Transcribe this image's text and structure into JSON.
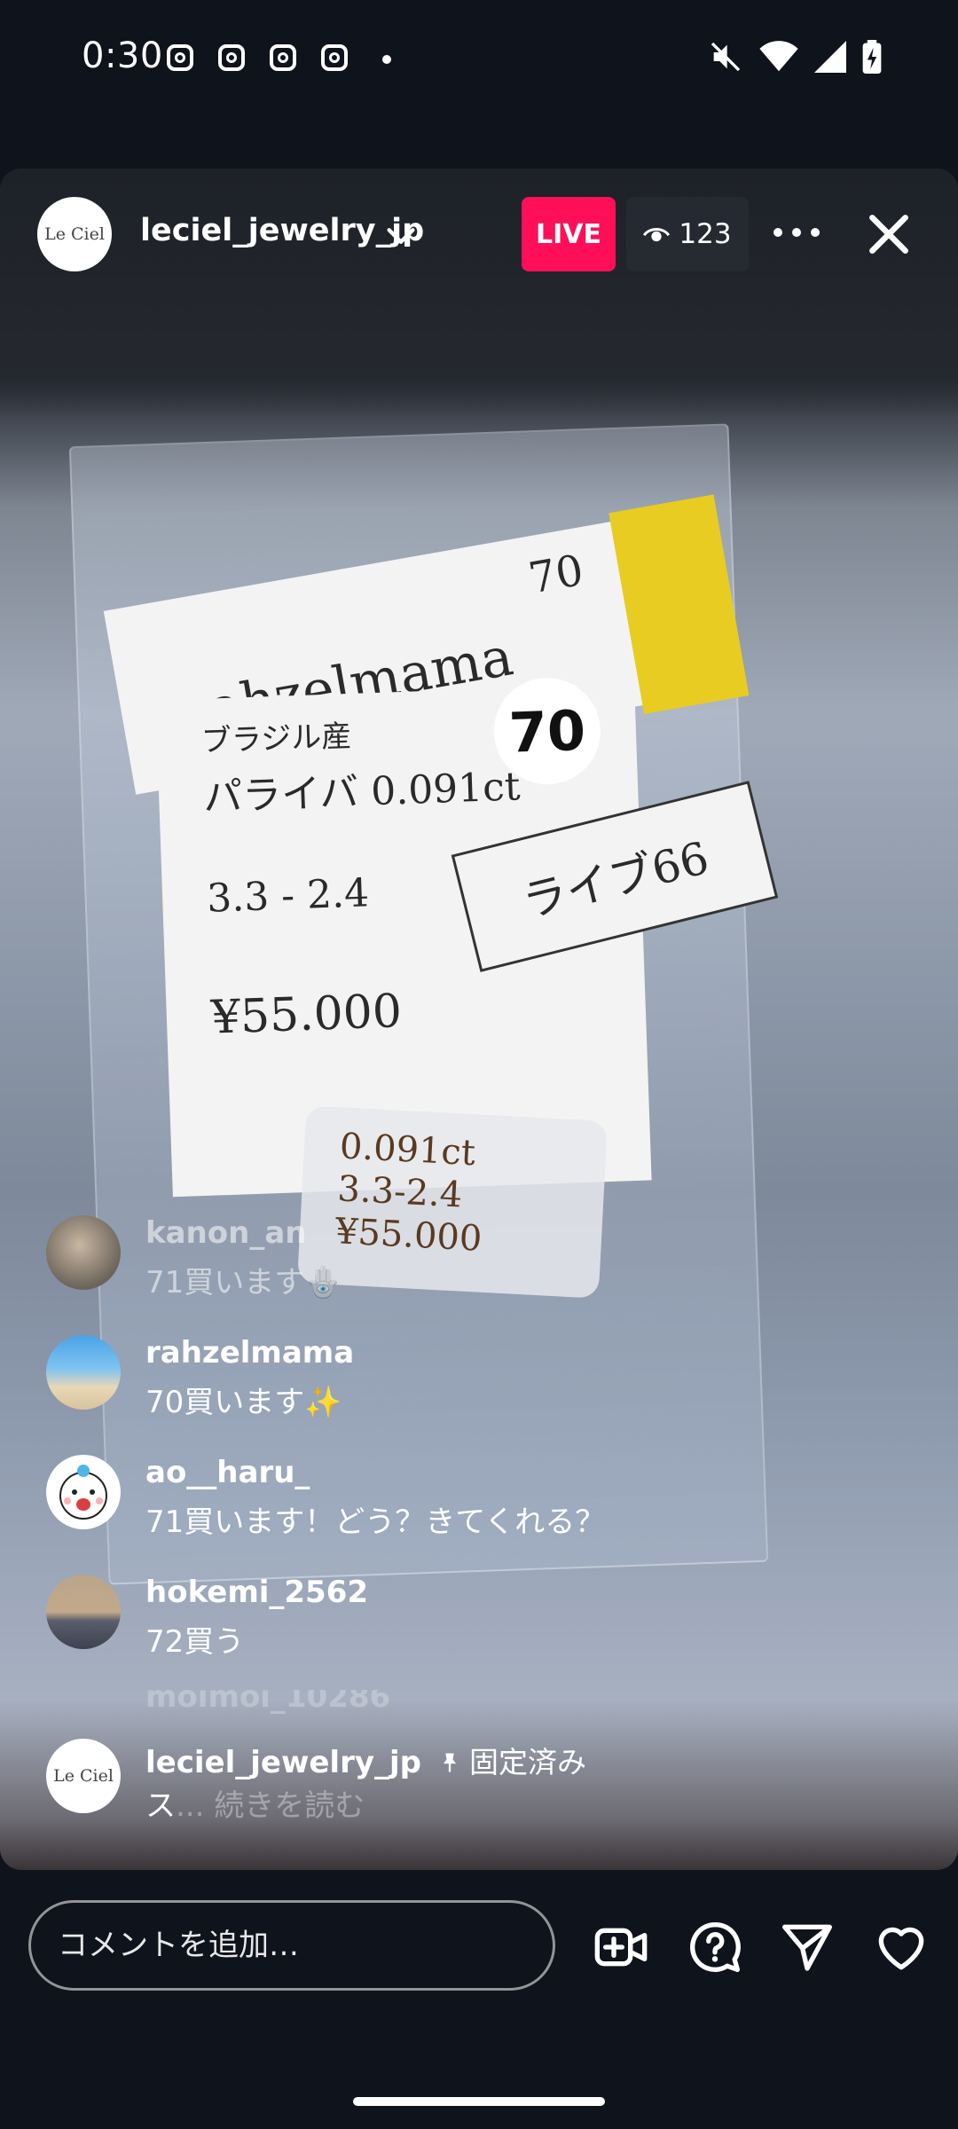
{
  "status_bar": {
    "time": "0:30",
    "notification_icons": [
      "instagram-icon",
      "instagram-icon",
      "instagram-icon",
      "instagram-icon"
    ],
    "right_icons": [
      "mute-icon",
      "wifi-icon",
      "signal-icon",
      "battery-charging-icon"
    ]
  },
  "live": {
    "host_avatar_text": "Le Ciel",
    "host_name": "leciel_jewelry_jp",
    "live_label": "LIVE",
    "viewer_count": "123"
  },
  "video_scene": {
    "tag_name": "rahzelmama",
    "tag_number": "70",
    "origin": "ブラジル産",
    "stone": "パライバ 0.091ct",
    "size": "3.3 - 2.4",
    "price": "¥55.000",
    "lot_badge": "70",
    "live_tag": "ライブ66",
    "ring_label_1": "0.091ct",
    "ring_label_2": "3.3-2.4",
    "ring_label_3": "¥55.000"
  },
  "comments": [
    {
      "user": "kanon_an",
      "text": "71買います🪬",
      "faded": true
    },
    {
      "user": "rahzelmama",
      "text": "70買います✨",
      "faded": false
    },
    {
      "user": "ao__haru_",
      "text": "71買います！どう？きてくれる？",
      "faded": false
    },
    {
      "user": "hokemi_2562",
      "text": "72買う",
      "faded": false
    }
  ],
  "hidden_comment_user": "moimoi_10286",
  "pinned": {
    "user": "leciel_jewelry_jp",
    "pin_label": "固定済み",
    "text": "ス",
    "read_more": "... 続きを読む"
  },
  "bottom": {
    "comment_placeholder": "コメントを追加…",
    "icons": [
      "add-video-icon",
      "question-icon",
      "send-icon",
      "heart-icon"
    ]
  },
  "colors": {
    "live_red": "#ff0f58",
    "background": "#0f131b"
  }
}
